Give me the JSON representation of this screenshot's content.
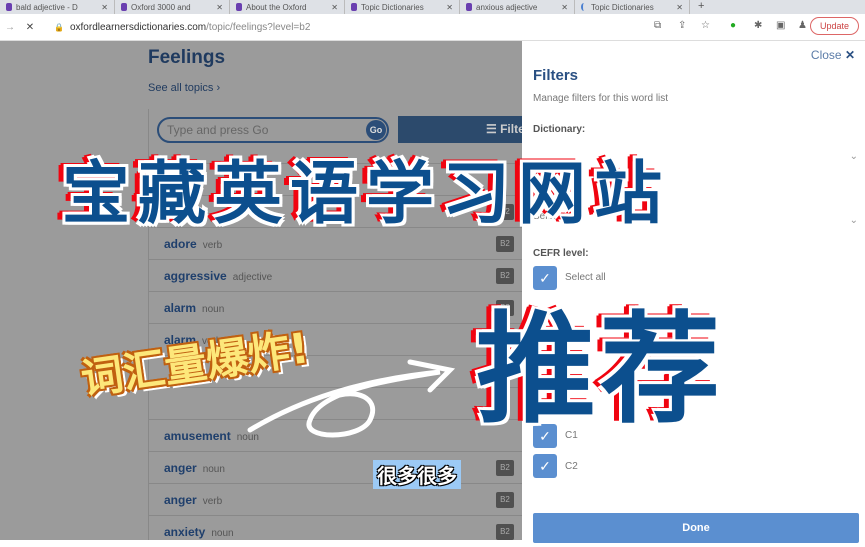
{
  "browser": {
    "tabs": [
      "bald adjective - D",
      "Oxford 3000 and",
      "About the Oxford",
      "Topic Dictionaries",
      "anxious adjective",
      "Topic Dictionaries"
    ],
    "url_domain": "oxfordlearnersdictionaries.com",
    "url_path": "/topic/feelings?level=b2",
    "update_label": "Update"
  },
  "main": {
    "title": "Feelings",
    "see_all": "See all topics ›",
    "search_placeholder": "Type and press Go",
    "go_label": "Go",
    "filter_label": "☰ Filte",
    "rows": [
      {
        "word": "",
        "pos": "",
        "level": ""
      },
      {
        "word": "",
        "pos": "",
        "level": "B2"
      },
      {
        "word": "adore",
        "pos": "verb",
        "level": "B2"
      },
      {
        "word": "aggressive",
        "pos": "adjective",
        "level": "B2"
      },
      {
        "word": "alarm",
        "pos": "noun",
        "level": "B2"
      },
      {
        "word": "alarm",
        "pos": "verb",
        "level": ""
      },
      {
        "word": "",
        "pos": "",
        "level": ""
      },
      {
        "word": "",
        "pos": "",
        "level": ""
      },
      {
        "word": "amusement",
        "pos": "noun",
        "level": ""
      },
      {
        "word": "anger",
        "pos": "noun",
        "level": "B2"
      },
      {
        "word": "anger",
        "pos": "verb",
        "level": "B2"
      },
      {
        "word": "anxiety",
        "pos": "noun",
        "level": "B2"
      }
    ]
  },
  "filters": {
    "close_label": "Close",
    "title": "Filters",
    "subtitle": "Manage filters for this word list",
    "dictionary_label": "Dictionary:",
    "subject_label": "Sub",
    "subject_value": "Select",
    "cefr_label": "CEFR level:",
    "select_all": "Select all",
    "c1": "C1",
    "c2": "C2",
    "done_label": "Done"
  },
  "overlay": {
    "title": "宝藏英语学习网站",
    "recommend": "推荐",
    "vocab": "词汇量爆炸!",
    "many": "很多很多"
  },
  "colors": {
    "overlay_blue": "#0c4f8e",
    "overlay_red": "#f00410",
    "accent": "#5b8fd0"
  }
}
